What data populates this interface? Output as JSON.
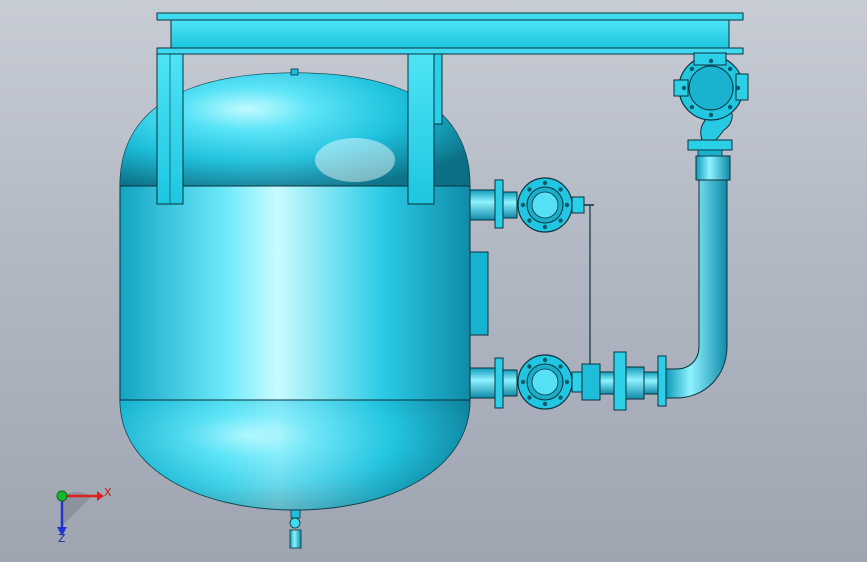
{
  "colors": {
    "background_top": "#c7ccd5",
    "background_bottom": "#9ea5b1",
    "model_fill": "#18c4e0",
    "model_light": "#bff7ff",
    "model_dark": "#0d6f86",
    "edge": "#08323c",
    "axis_x": "#e02020",
    "axis_y": "#19b82a",
    "axis_z": "#2035d0"
  },
  "icons": {
    "triad": "coordinate-triad-icon",
    "origin": "origin-sphere-icon"
  },
  "triad": {
    "x_label": "X",
    "z_label": "Z"
  }
}
